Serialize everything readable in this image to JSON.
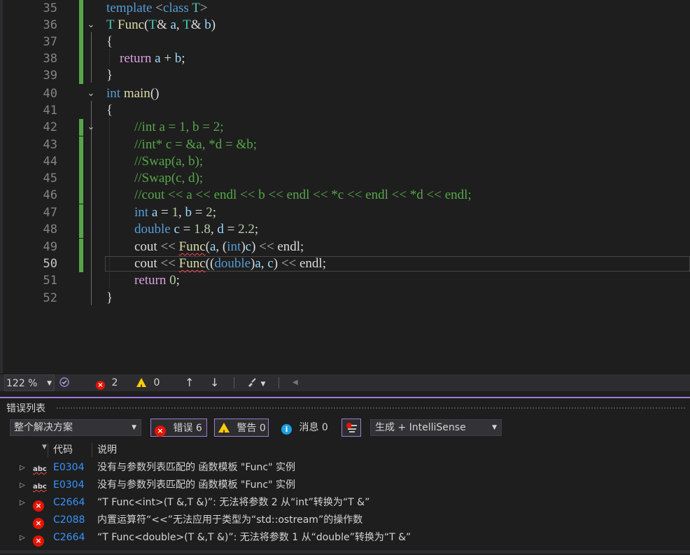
{
  "editor": {
    "lines": [
      {
        "num": "35",
        "code": "template <class T>"
      },
      {
        "num": "36",
        "code": "T Func(T& a, T& b)"
      },
      {
        "num": "37",
        "code": "{"
      },
      {
        "num": "38",
        "code": "return a + b;"
      },
      {
        "num": "39",
        "code": "}"
      },
      {
        "num": "40",
        "code": "int main()"
      },
      {
        "num": "41",
        "code": "{"
      },
      {
        "num": "42",
        "code": "//int a = 1, b = 2;"
      },
      {
        "num": "43",
        "code": "//int* c = &a, *d = &b;"
      },
      {
        "num": "44",
        "code": "//Swap(a, b);"
      },
      {
        "num": "45",
        "code": "//Swap(c, d);"
      },
      {
        "num": "46",
        "code": "//cout << a << endl << b << endl << *c << endl << *d << endl;"
      },
      {
        "num": "47",
        "code": "int a = 1, b = 2;"
      },
      {
        "num": "48",
        "code": "double c = 1.8, d = 2.2;"
      },
      {
        "num": "49",
        "code": "cout << Func(a, (int)c) << endl;"
      },
      {
        "num": "50",
        "code": "cout << Func((double)a, c) << endl;"
      },
      {
        "num": "51",
        "code": "return 0;"
      },
      {
        "num": "52",
        "code": "}"
      }
    ],
    "current_line": "50"
  },
  "statusbar": {
    "zoom": "122 %",
    "errors": "2",
    "warnings": "0"
  },
  "error_list": {
    "title": "错误列表",
    "scope": "整个解决方案",
    "errors_btn": "错误 6",
    "warnings_btn": "警告 0",
    "messages_btn": "消息 0",
    "build_source": "生成 + IntelliSense",
    "col_code": "代码",
    "col_desc": "说明",
    "rows": [
      {
        "icon": "abc",
        "expandable": true,
        "code": "E0304",
        "desc": "没有与参数列表匹配的 函数模板 \"Func\" 实例"
      },
      {
        "icon": "abc",
        "expandable": true,
        "code": "E0304",
        "desc": "没有与参数列表匹配的 函数模板 \"Func\" 实例"
      },
      {
        "icon": "error",
        "expandable": true,
        "code": "C2664",
        "desc": "“T Func<int>(T &,T &)”: 无法将参数 2 从“int”转换为“T &”"
      },
      {
        "icon": "error",
        "expandable": false,
        "code": "C2088",
        "desc": "内置运算符“<<”无法应用于类型为“std::ostream”的操作数"
      },
      {
        "icon": "error",
        "expandable": true,
        "code": "C2664",
        "desc": "“T Func<double>(T &,T &)”: 无法将参数 1 从“double”转换为“T &”"
      }
    ]
  },
  "colors": {
    "accent": "#9d7cd8",
    "error": "#e51400",
    "warning": "#ffcc00",
    "info": "#1ba1e2",
    "code_link": "#3794ff",
    "change_bar": "#57a64a"
  },
  "icons": {
    "fold": "chevron-down-icon",
    "expand": "triangle-right-icon",
    "error": "error-circle-icon",
    "warning": "warning-triangle-icon",
    "info": "info-circle-icon",
    "filter": "filter-icon",
    "spell": "abc-squiggle-icon"
  }
}
